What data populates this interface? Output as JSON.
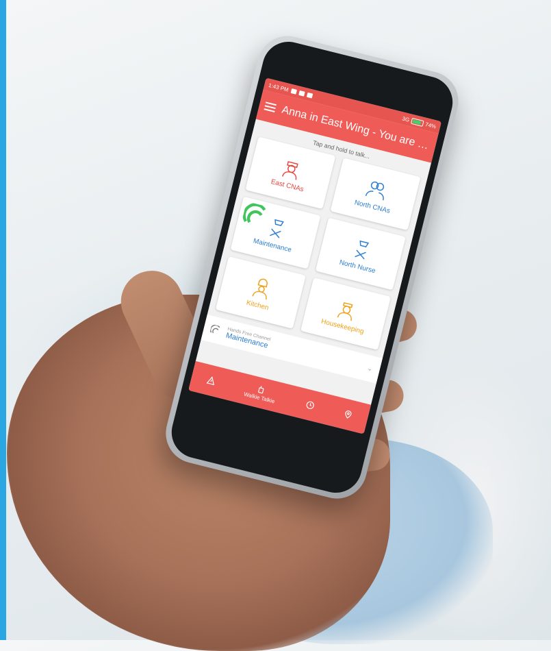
{
  "status_bar": {
    "time": "1:43 PM",
    "network": "3G",
    "battery": "74%"
  },
  "app_bar": {
    "title": "Anna in East Wing - You are o..."
  },
  "hint": "Tap and hold to talk...",
  "channels": [
    {
      "label": "East CNAs",
      "color": "#e8463f",
      "icon": "nurse-icon"
    },
    {
      "label": "North CNAs",
      "color": "#2d7fd0",
      "icon": "group-icon"
    },
    {
      "label": "Maintenance",
      "color": "#2d7fd0",
      "icon": "tools-icon",
      "hands_free": true
    },
    {
      "label": "North Nurse",
      "color": "#2d7fd0",
      "icon": "tools-icon"
    },
    {
      "label": "Kitchen",
      "color": "#f0a21a",
      "icon": "chef-icon"
    },
    {
      "label": "Housekeeping",
      "color": "#f0a21a",
      "icon": "housekeeper-icon"
    }
  ],
  "hands_free": {
    "caption": "Hands Free Channel",
    "channel": "Maintenance"
  },
  "bottom_nav": {
    "alert_icon": "warning-icon",
    "walkie_label": "Walkie Talkie",
    "history_icon": "clock-icon",
    "location_icon": "pin-icon"
  },
  "colors": {
    "accent": "#ef5b56",
    "side_stripe": "#2aa7e2"
  }
}
